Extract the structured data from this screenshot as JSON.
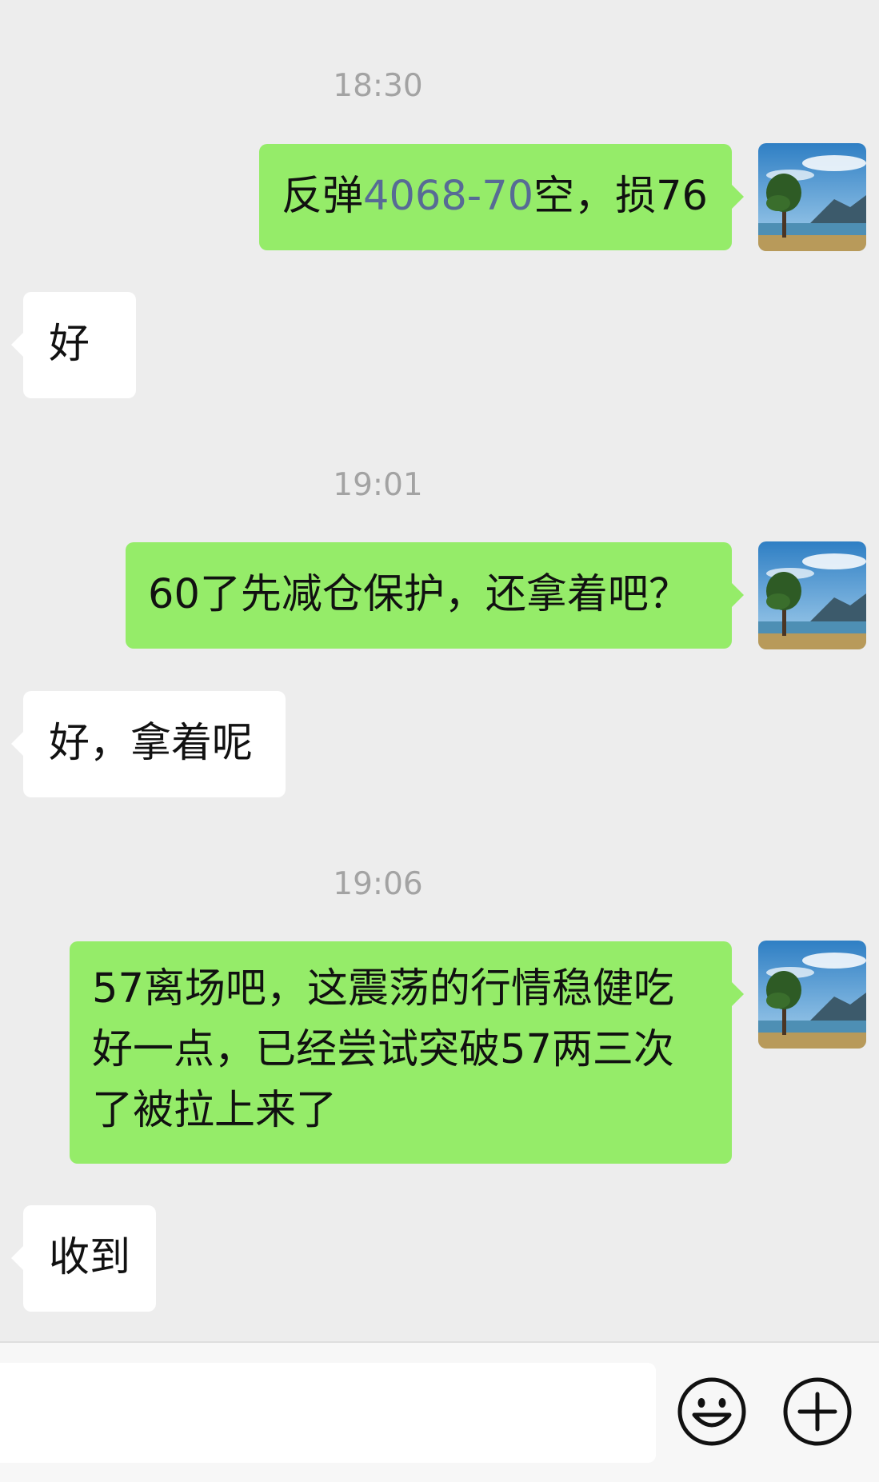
{
  "messages": [
    {
      "time": "18:30"
    },
    {
      "sender": "me",
      "text_pre": "反弹",
      "text_link": "4068-70",
      "text_post": "空，损76"
    },
    {
      "sender": "other",
      "text": "好"
    },
    {
      "time": "19:01"
    },
    {
      "sender": "me",
      "text": "60了先减仓保护，还拿着吧？"
    },
    {
      "sender": "other",
      "text": "好，拿着呢"
    },
    {
      "time": "19:06"
    },
    {
      "sender": "me",
      "lines": [
        "57离场吧，这震荡的行情稳健吃",
        "好一点，已经尝试突破57两三次",
        "了被拉上来了"
      ]
    },
    {
      "sender": "other",
      "text": "收到"
    }
  ],
  "colors": {
    "background": "#ededed",
    "my_bubble": "#95ec69",
    "other_bubble": "#ffffff",
    "link": "#576b95",
    "timestamp": "#a3a3a3"
  },
  "avatar_icon": "landscape-avatar",
  "input_bar": {
    "value": "",
    "emoji_icon": "smiley-icon",
    "more_icon": "plus-circle-icon"
  }
}
